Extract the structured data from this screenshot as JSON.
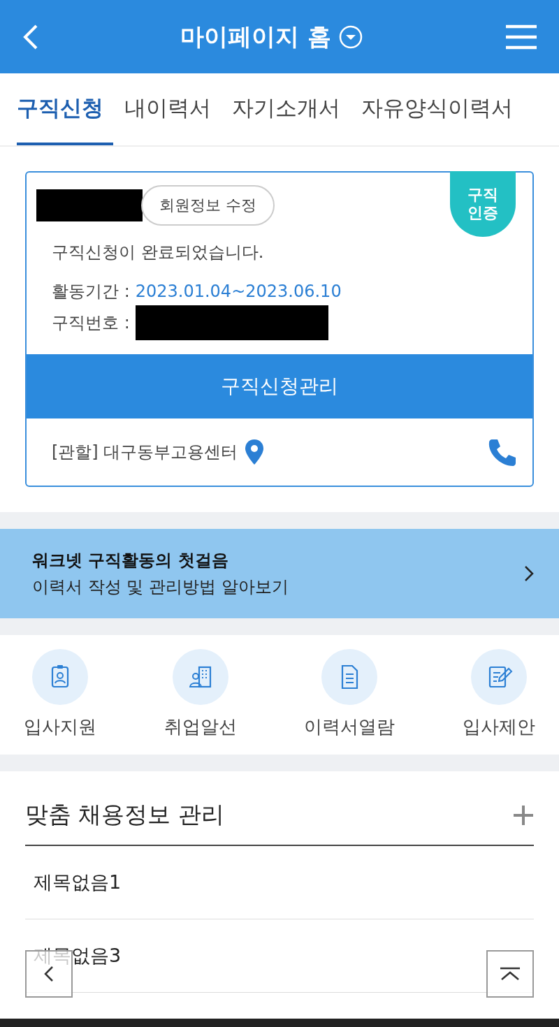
{
  "header": {
    "title": "마이페이지 홈"
  },
  "tabs": [
    {
      "label": "구직신청",
      "selected": true
    },
    {
      "label": "내이력서",
      "selected": false
    },
    {
      "label": "자기소개서",
      "selected": false
    },
    {
      "label": "자유양식이력서",
      "selected": false
    }
  ],
  "card": {
    "name_redacted": true,
    "edit_button": "회원정보 수정",
    "badge": "구직\n인증",
    "status": "구직신청이 완료되었습니다.",
    "period_label": "활동기간 :",
    "period_value": "2023.01.04~2023.06.10",
    "number_label": "구직번호 :",
    "number_redacted": true,
    "manage_button": "구직신청관리",
    "office": "[관할] 대구동부고용센터"
  },
  "banner": {
    "title": "워크넷 구직활동의 첫걸음",
    "subtitle": "이력서 작성 및 관리방법 알아보기"
  },
  "shortcuts": [
    {
      "kind": "apply",
      "label": "입사지원"
    },
    {
      "kind": "building",
      "label": "취업알선"
    },
    {
      "kind": "document",
      "label": "이력서열람"
    },
    {
      "kind": "edit",
      "label": "입사제안"
    }
  ],
  "custom_jobs": {
    "title": "맞춤 채용정보 관리",
    "items": [
      "제목없음1",
      "제목없음3"
    ]
  }
}
